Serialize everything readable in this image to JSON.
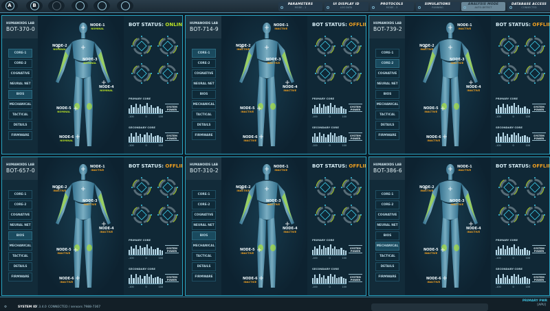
{
  "topbar": {
    "circle_buttons": [
      {
        "label": "A",
        "icon": "a-button-icon"
      },
      {
        "label": "B",
        "icon": "b-button-icon"
      },
      {
        "label": "",
        "icon": "user-icon"
      },
      {
        "label": "",
        "icon": "dpad-icon"
      },
      {
        "label": "",
        "icon": "document-icon"
      },
      {
        "label": "",
        "icon": "power-icon"
      }
    ],
    "tabs": [
      {
        "title": "PARAMETERS",
        "sub": "MODE - 1"
      },
      {
        "title": "UI DISPLAY ID",
        "sub": "LOG DATA"
      },
      {
        "title": "PROTOCOLS",
        "sub": "MODE - 3"
      },
      {
        "title": "SIMULATIONS",
        "sub": "RUNNING"
      },
      {
        "title": "ANALYSIS MODE",
        "sub": "AUTO-DETECT"
      },
      {
        "title": "DATABASE ACCESS",
        "sub": "CONNECTED"
      }
    ],
    "active_tab": 4
  },
  "labels": {
    "lab": "HUMANOIDS LAB",
    "status_prefix": "BOT STATUS: ",
    "primary_core": "PRIMARY CORE",
    "secondary_core": "SECONDARY CORE",
    "system_power": "SYSTEM POWER",
    "axis": [
      "-100",
      "0",
      "100"
    ]
  },
  "nav_items": [
    "CORE-1",
    "CORE-2",
    "COGNATIVE",
    "NEURAL NET",
    "BIOS",
    "MECHANICAL",
    "TACTICAL",
    "DETAILS",
    "FIRMWARE"
  ],
  "colors": {
    "online": "#b8e026",
    "offline": "#f0a020",
    "nominal": "#b8e026",
    "inactive": "#f0a020",
    "accent": "#2aa6c4"
  },
  "bots": [
    {
      "id": "BOT-370-0",
      "status": "ONLINE",
      "node_state": "NOMINAL",
      "active_nav": [
        0,
        4
      ]
    },
    {
      "id": "BOT-714-9",
      "status": "OFFLINE",
      "node_state": "INACTIVE",
      "active_nav": [
        0
      ]
    },
    {
      "id": "BOT-739-2",
      "status": "OFFLINE",
      "node_state": "INACTIVE",
      "active_nav": [
        1
      ]
    },
    {
      "id": "BOT-657-0",
      "status": "OFFLINE",
      "node_state": "INACTIVE",
      "active_nav": [
        4
      ]
    },
    {
      "id": "BOT-310-2",
      "status": "OFFLINE",
      "node_state": "INACTIVE",
      "active_nav": [
        4
      ]
    },
    {
      "id": "BOT-386-6",
      "status": "OFFLINE",
      "node_state": "INACTIVE",
      "active_nav": [
        5
      ]
    }
  ],
  "nodes": [
    "NODE-1",
    "NODE-2",
    "NODE-3",
    "NODE-4",
    "NODE-5",
    "NODE-6"
  ],
  "primary_core_levels": [
    40,
    70,
    55,
    80,
    50,
    75,
    60,
    65,
    90,
    55,
    70,
    45,
    50,
    60,
    40,
    35
  ],
  "secondary_core_levels": [
    50,
    75,
    45,
    85,
    55,
    70,
    40,
    65,
    80,
    60,
    75,
    45,
    55,
    60,
    45,
    40
  ],
  "bottombar": {
    "system_id": "SYSTEM ID",
    "version": "7.3.4.0",
    "connection": "CONNECTED / sensors 7988-7367",
    "right_label": "PRIMARY PWR",
    "right_sub": "[APU]"
  }
}
